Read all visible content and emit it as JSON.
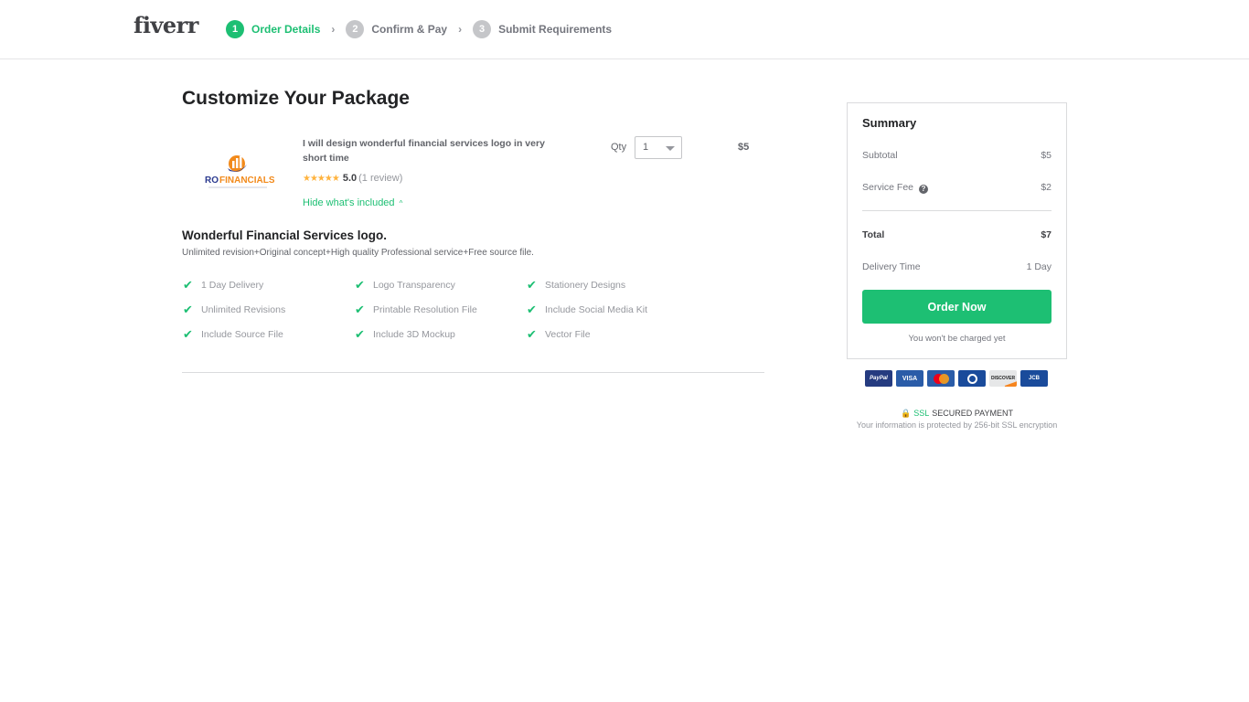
{
  "header": {
    "logo": "fiverr",
    "steps": [
      {
        "number": "1",
        "label": "Order Details",
        "active": true
      },
      {
        "number": "2",
        "label": "Confirm & Pay",
        "active": false
      },
      {
        "number": "3",
        "label": "Submit Requirements",
        "active": false
      }
    ],
    "separator": "›"
  },
  "main": {
    "title": "Customize Your Package",
    "gig": {
      "logo_text_primary": "RO",
      "logo_text_secondary": "FINANCIALS",
      "title": "I will design wonderful financial services logo in very short time",
      "stars": "★★★★★",
      "rating": "5.0",
      "review_count": "(1 review)",
      "hide_link": "Hide what's included",
      "hide_caret": "^",
      "qty_label": "Qty",
      "qty_value": "1",
      "price": "$5"
    },
    "package": {
      "title": "Wonderful Financial Services logo.",
      "description": "Unlimited revision+Original concept+High quality Professional service+Free source file.",
      "features": [
        "1 Day Delivery",
        "Logo Transparency",
        "Stationery Designs",
        "Unlimited Revisions",
        "Printable Resolution File",
        "Include Social Media Kit",
        "Include Source File",
        "Include 3D Mockup",
        "Vector File"
      ]
    }
  },
  "summary": {
    "title": "Summary",
    "subtotal_label": "Subtotal",
    "subtotal_value": "$5",
    "service_fee_label": "Service Fee",
    "service_fee_value": "$2",
    "total_label": "Total",
    "total_value": "$7",
    "delivery_label": "Delivery Time",
    "delivery_value": "1 Day",
    "order_button": "Order Now",
    "charged_note": "You won't be charged yet"
  },
  "payment": {
    "cards": [
      "PayPal",
      "VISA",
      "MasterCard",
      "Diners Club",
      "DISCOVER",
      "JCB"
    ],
    "ssl_word": "SSL",
    "ssl_label": "SECURED PAYMENT",
    "ssl_note": "Your information is protected by 256-bit SSL encryption"
  },
  "colors": {
    "accent": "#1dbf73",
    "star": "#ffb33e"
  }
}
